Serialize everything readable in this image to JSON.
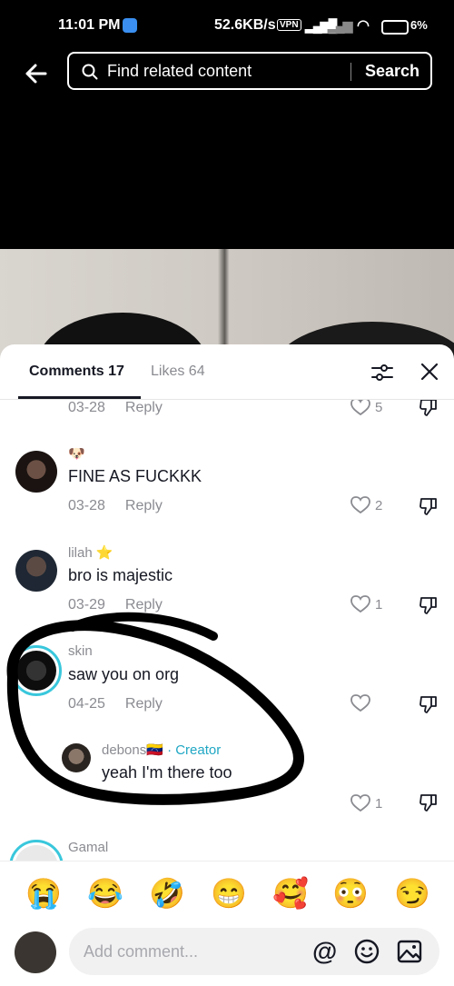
{
  "status_bar": {
    "time": "11:01 PM",
    "speed": "52.6KB/s",
    "vpn": "VPN",
    "battery": "6%"
  },
  "search": {
    "placeholder": "Find related content",
    "button": "Search"
  },
  "tabs": {
    "comments": "Comments 17",
    "likes": "Likes 64"
  },
  "comments": [
    {
      "username": "",
      "text": "",
      "date": "03-28",
      "reply": "Reply",
      "likes": "5"
    },
    {
      "username": "🐶",
      "text": "FINE AS FUCKKK",
      "date": "03-28",
      "reply": "Reply",
      "likes": "2"
    },
    {
      "username": "lilah ⭐",
      "text": "bro is majestic",
      "date": "03-29",
      "reply": "Reply",
      "likes": "1"
    },
    {
      "username": "skin",
      "text": "saw you on org",
      "date": "04-25",
      "reply": "Reply",
      "likes": "",
      "reply_item": {
        "username": "debons🇻🇪",
        "creator": "· Creator",
        "text": "yeah I'm there too",
        "likes": "1"
      }
    },
    {
      "username": "Gamal",
      "text": "",
      "date": "",
      "reply": "",
      "likes": ""
    }
  ],
  "emojis": [
    "😭",
    "😂",
    "🤣",
    "😁",
    "🥰",
    "😳",
    "😏"
  ],
  "composer": {
    "placeholder": "Add comment...",
    "at": "@"
  },
  "colors": {
    "accent": "#20a7c4",
    "ring": "#39c7dc"
  }
}
